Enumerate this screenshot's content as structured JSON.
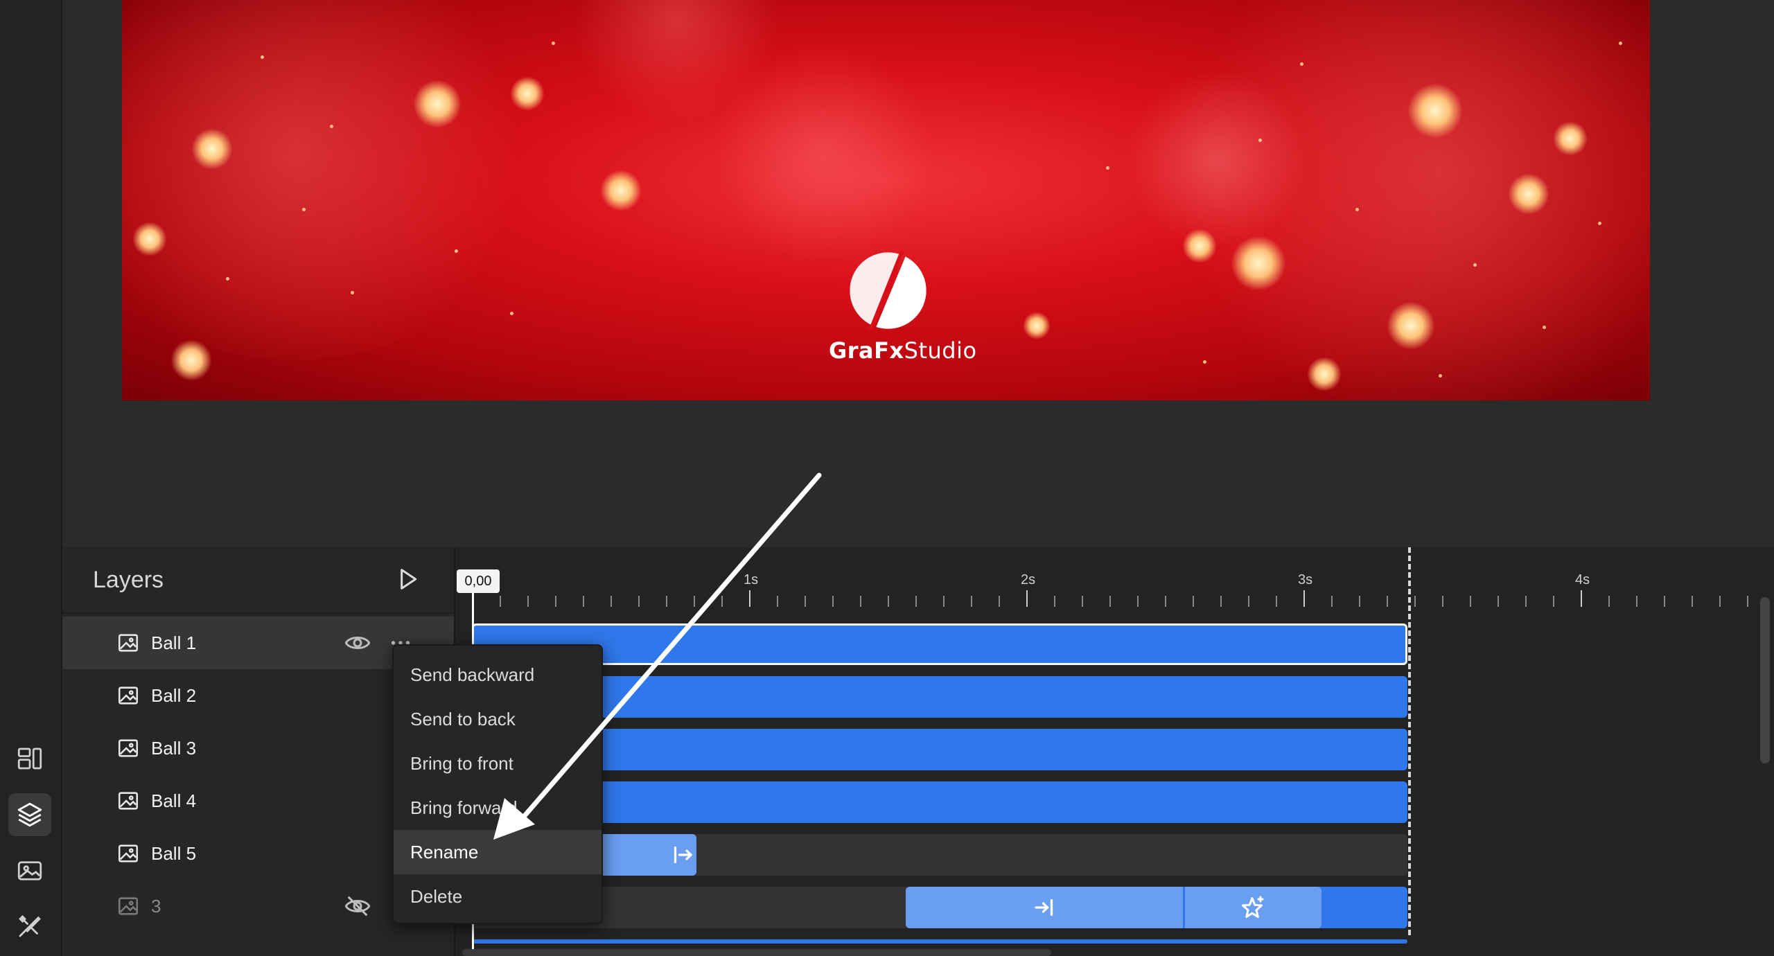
{
  "artboard": {
    "logo_bold": "GraFx",
    "logo_regular": "Studio"
  },
  "layers_panel": {
    "title": "Layers",
    "layers": [
      {
        "name": "Ball 1",
        "selected": true,
        "hidden": false
      },
      {
        "name": "Ball 2",
        "selected": false,
        "hidden": false
      },
      {
        "name": "Ball 3",
        "selected": false,
        "hidden": false
      },
      {
        "name": "Ball 4",
        "selected": false,
        "hidden": false
      },
      {
        "name": "Ball 5",
        "selected": false,
        "hidden": false
      },
      {
        "name": "3",
        "selected": false,
        "hidden": true
      }
    ]
  },
  "timeline": {
    "current_time": "0,00",
    "tick_labels": [
      "1s",
      "2s",
      "3s",
      "4s"
    ]
  },
  "context_menu": {
    "items": [
      {
        "label": "Send backward",
        "highlighted": false
      },
      {
        "label": "Send to back",
        "highlighted": false
      },
      {
        "label": "Bring to front",
        "highlighted": false
      },
      {
        "label": "Bring forward",
        "highlighted": false
      },
      {
        "label": "Rename",
        "highlighted": true
      },
      {
        "label": "Delete",
        "highlighted": false
      }
    ]
  },
  "colors": {
    "accent_bar": "#2f77ea",
    "accent_bar_light": "#6a9ef0",
    "artboard_red": "#d80f18"
  },
  "icons": {
    "rail": [
      "layout-icon",
      "layers-icon",
      "image-icon",
      "brush-icon"
    ]
  }
}
